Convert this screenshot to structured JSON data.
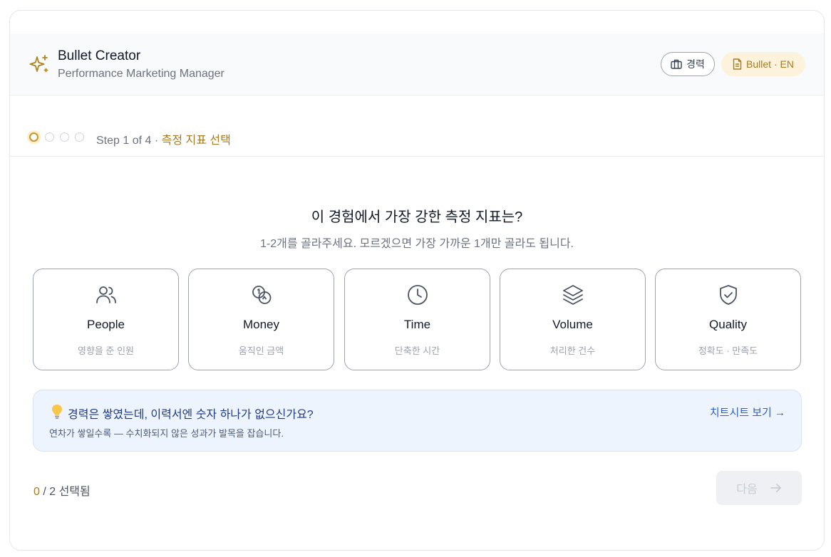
{
  "header": {
    "title": "Bullet Creator",
    "subtitle": "Performance Marketing Manager",
    "badge_career": "경력",
    "badge_bullet": "Bullet · EN",
    "accent_color": "#c9962a"
  },
  "stepper": {
    "total_steps": 4,
    "current_step": 1,
    "step_label": "Step 1 of 4 · ",
    "step_name": "측정 지표 선택"
  },
  "question": {
    "title": "이 경험에서 가장 강한 측정 지표는?",
    "hint": "1-2개를 골라주세요. 모르겠으면 가장 가까운 1개만 골라도 됩니다."
  },
  "options": [
    {
      "label": "People",
      "sub": "영향을 준 인원",
      "icon": "people-icon"
    },
    {
      "label": "Money",
      "sub": "움직인 금액",
      "icon": "coins-icon"
    },
    {
      "label": "Time",
      "sub": "단축한 시간",
      "icon": "clock-icon"
    },
    {
      "label": "Volume",
      "sub": "처리한 건수",
      "icon": "layers-icon"
    },
    {
      "label": "Quality",
      "sub": "정확도 · 만족도",
      "icon": "shield-check-icon"
    }
  ],
  "tip": {
    "title": "경력은 쌓였는데, 이력서엔 숫자 하나가 없으신가요?",
    "body": "연차가 쌓일수록 — 수치화되지 않은 성과가 발목을 잡습니다.",
    "link": "치트시트 보기 →"
  },
  "footer": {
    "selected_count": "0",
    "selected_suffix": " / 2 선택됨",
    "next_label": "다음"
  }
}
